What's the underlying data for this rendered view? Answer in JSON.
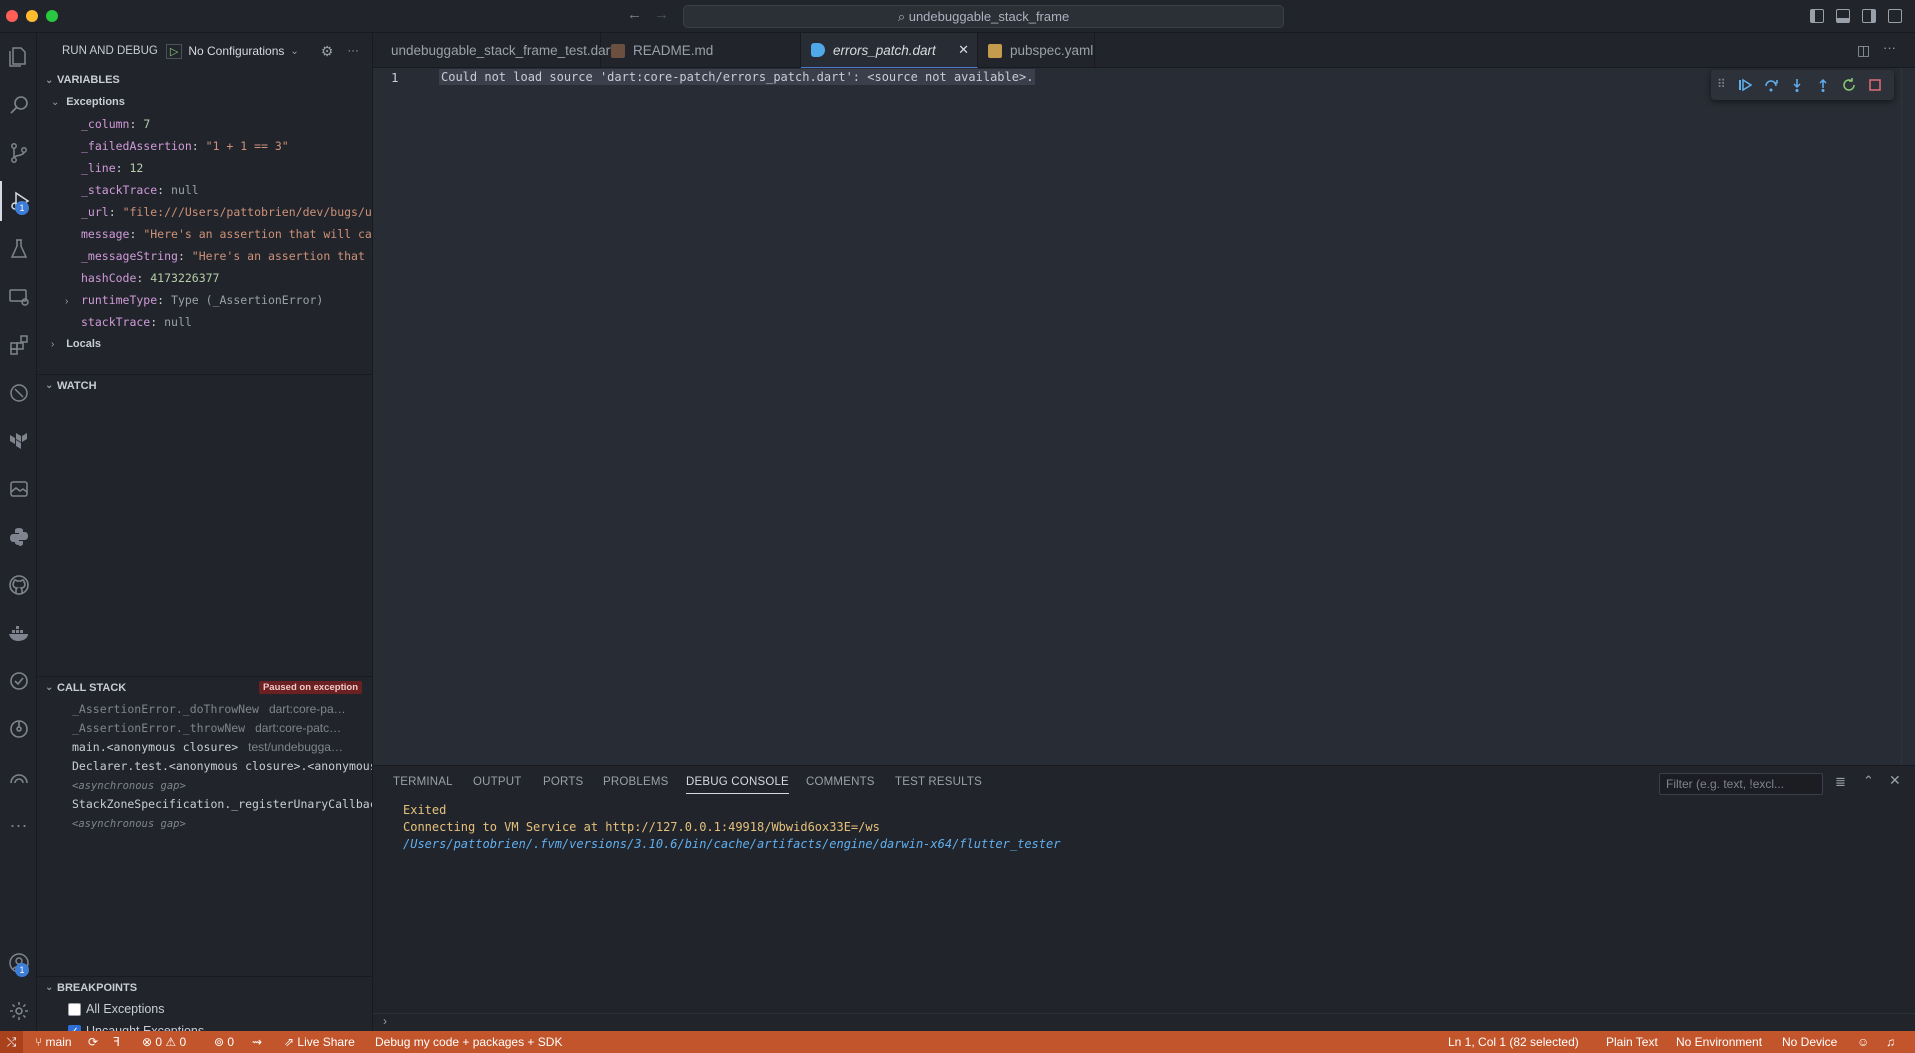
{
  "window": {
    "title": "undebuggable_stack_frame"
  },
  "sidebar": {
    "header": "RUN AND DEBUG",
    "config": "No Configurations",
    "variables": {
      "title": "VARIABLES",
      "exceptions_label": "Exceptions",
      "items": [
        {
          "name": "_column",
          "value": "7",
          "kind": "num"
        },
        {
          "name": "_failedAssertion",
          "value": "\"1 + 1 == 3\"",
          "kind": "str"
        },
        {
          "name": "_line",
          "value": "12",
          "kind": "num"
        },
        {
          "name": "_stackTrace",
          "value": "null",
          "kind": "null"
        },
        {
          "name": "_url",
          "value": "\"file:///Users/pattobrien/dev/bugs/un…",
          "kind": "str"
        },
        {
          "name": "message",
          "value": "\"Here's an assertion that will cau…",
          "kind": "str"
        },
        {
          "name": "_messageString",
          "value": "\"Here's an assertion that w…",
          "kind": "str"
        },
        {
          "name": "hashCode",
          "value": "4173226377",
          "kind": "num"
        },
        {
          "name": "runtimeType",
          "value": "Type (_AssertionError)",
          "kind": "type"
        },
        {
          "name": "stackTrace",
          "value": "null",
          "kind": "null"
        }
      ],
      "locals_label": "Locals"
    },
    "watch": {
      "title": "WATCH"
    },
    "callstack": {
      "title": "CALL STACK",
      "badge": "Paused on exception",
      "frames": [
        {
          "fn": "_AssertionError._doThrowNew",
          "src": "dart:core-pa…",
          "dim": true
        },
        {
          "fn": "_AssertionError._throwNew",
          "src": "dart:core-patc…",
          "dim": true
        },
        {
          "fn": "main.<anonymous closure>",
          "src": "test/undebugga…",
          "dim": false
        },
        {
          "fn": "Declarer.test.<anonymous closure>.<anonymous c",
          "src": "",
          "dim": false
        },
        {
          "fn": "<asynchronous gap>",
          "src": "",
          "dim": true,
          "italic": true
        },
        {
          "fn": "StackZoneSpecification._registerUnaryCallback…",
          "src": "",
          "dim": false
        },
        {
          "fn": "<asynchronous gap>",
          "src": "",
          "dim": true,
          "italic": true
        }
      ]
    },
    "breakpoints": {
      "title": "BREAKPOINTS",
      "items": [
        {
          "label": "All Exceptions",
          "checked": false
        },
        {
          "label": "Uncaught Exceptions",
          "checked": true
        }
      ]
    }
  },
  "tabs": [
    {
      "label": "undebuggable_stack_frame_test.dart",
      "icon": "dart-icon"
    },
    {
      "label": "README.md",
      "icon": "markdown-icon"
    },
    {
      "label": "errors_patch.dart",
      "icon": "dart-icon",
      "active": true
    },
    {
      "label": "pubspec.yaml",
      "icon": "yaml-icon"
    }
  ],
  "editor": {
    "line_number": "1",
    "content": "Could not load source 'dart:core-patch/errors_patch.dart': <source not available>."
  },
  "panel": {
    "tabs": [
      "TERMINAL",
      "OUTPUT",
      "PORTS",
      "PROBLEMS",
      "DEBUG CONSOLE",
      "COMMENTS",
      "TEST RESULTS"
    ],
    "active_tab": "DEBUG CONSOLE",
    "filter_placeholder": "Filter (e.g. text, !excl...",
    "console": [
      {
        "text": "Exited",
        "color": "#e5c07b"
      },
      {
        "text": "Connecting to VM Service at http://127.0.0.1:49918/Wbwid6ox33E=/ws",
        "color": "#e5c07b"
      },
      {
        "text": "/Users/pattobrien/.fvm/versions/3.10.6/bin/cache/artifacts/engine/darwin-x64/flutter_tester",
        "color": "#61afef"
      }
    ]
  },
  "statusbar": {
    "branch": "main",
    "errors": "0",
    "warnings": "0",
    "ports": "0",
    "live_share": "Live Share",
    "debug_mode": "Debug my code + packages + SDK",
    "cursor": "Ln 1, Col 1 (82 selected)",
    "language": "Plain Text",
    "environment": "No Environment",
    "device": "No Device"
  },
  "activity_badges": {
    "debug": "1",
    "accounts": "1"
  },
  "colors": {
    "statusbar": "#c2552b",
    "accent": "#4d78cc"
  }
}
